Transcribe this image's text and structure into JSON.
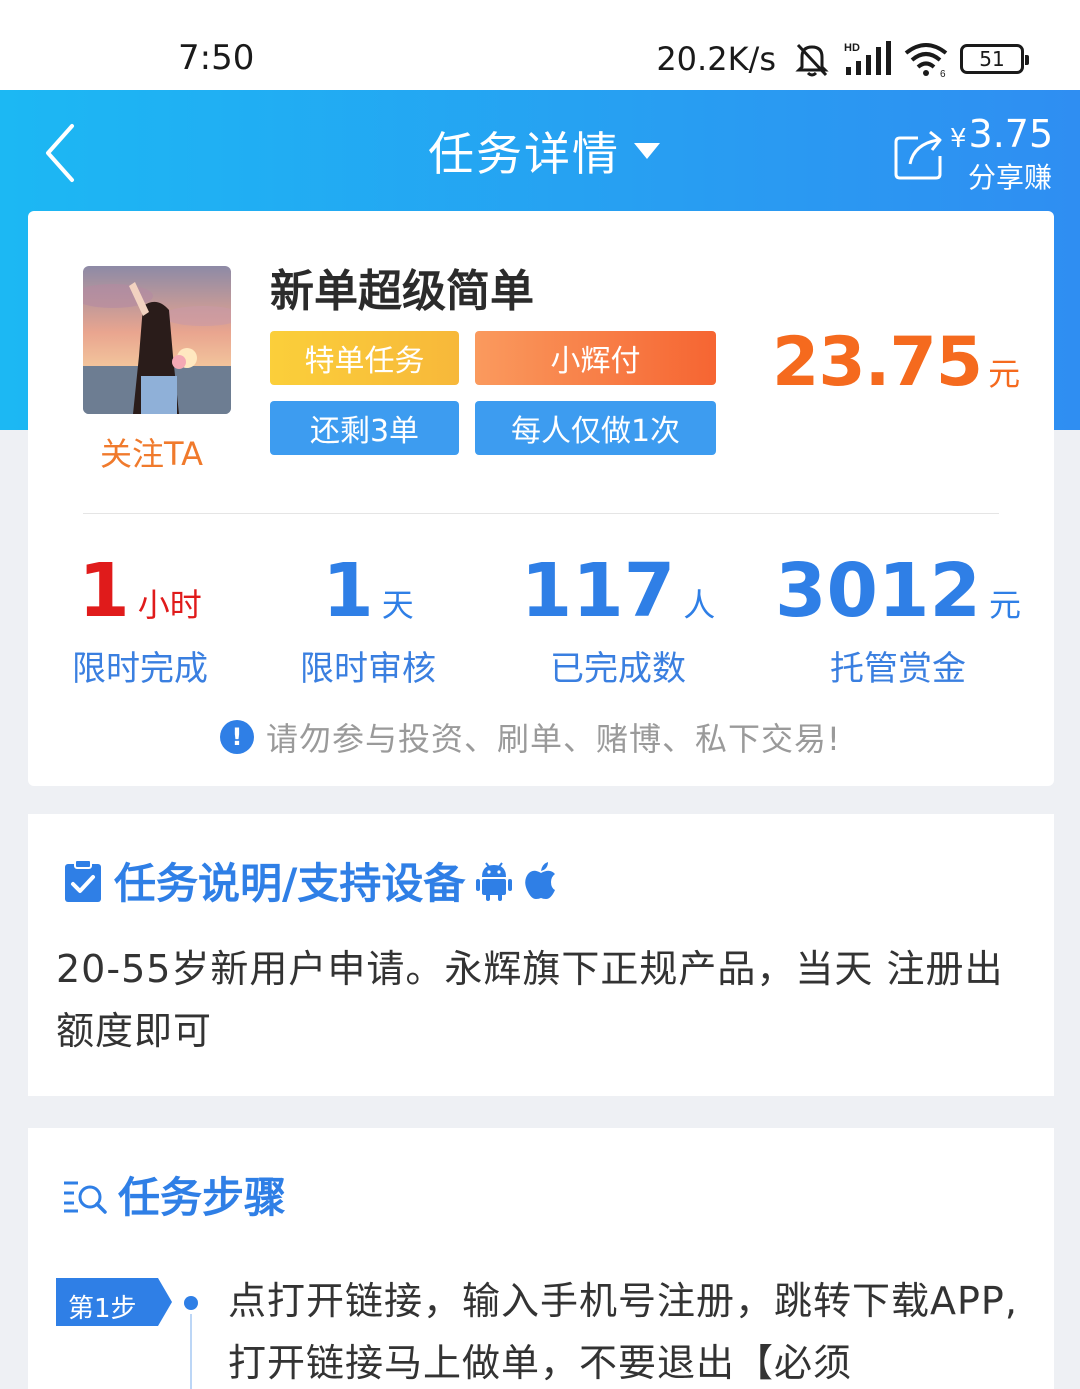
{
  "status_bar": {
    "time": "7:50",
    "net_speed": "20.2K/s",
    "battery": "51"
  },
  "header": {
    "title": "任务详情",
    "share_currency": "¥",
    "share_amount": "3.75",
    "share_label": "分享赚"
  },
  "task": {
    "title": "新单超级简单",
    "follow_label": "关注TA",
    "tags": [
      "特单任务",
      "小辉付",
      "还剩3单",
      "每人仅做1次"
    ],
    "price": "23.75",
    "price_unit": "元"
  },
  "stats": [
    {
      "value": "1",
      "unit": "小时",
      "label": "限时完成"
    },
    {
      "value": "1",
      "unit": "天",
      "label": "限时审核"
    },
    {
      "value": "117",
      "unit": "人",
      "label": "已完成数"
    },
    {
      "value": "3012",
      "unit": "元",
      "label": "托管赏金"
    }
  ],
  "warning": "请勿参与投资、刷单、赌博、私下交易!",
  "description": {
    "title": "任务说明/支持设备",
    "text": "20-55岁新用户申请。永辉旗下正规产品，当天 注册出额度即可"
  },
  "steps": {
    "title": "任务步骤",
    "items": [
      {
        "badge": "第1步",
        "text": "点打开链接，输入手机号注册，跳转下载APP,打开链接马上做单，不要退出【必须"
      }
    ]
  },
  "colors": {
    "accent_blue": "#2f7fe6",
    "header_start": "#1cb8f3",
    "header_end": "#2f8ef2",
    "price_orange": "#f56a1e",
    "time_red": "#e01b1b"
  }
}
